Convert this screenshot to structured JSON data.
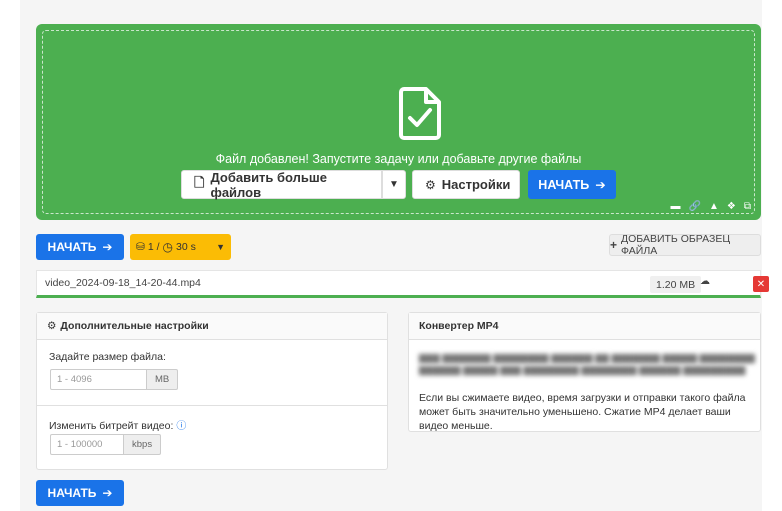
{
  "dropzone": {
    "message": "Файл добавлен! Запустите задачу или добавьте другие файлы",
    "add_more_label": "Добавить больше файлов",
    "settings_label": "Настройки",
    "start_label": "НАЧАТЬ",
    "bg_color": "#4caf50"
  },
  "toolbar": {
    "start_label": "НАЧАТЬ",
    "limit_files": "1 /",
    "limit_time": "30 s",
    "add_sample_label": "ДОБАВИТЬ ОБРАЗЕЦ ФАЙЛА"
  },
  "file": {
    "name": "video_2024-09-18_14-20-44.mp4",
    "size": "1.20 MB"
  },
  "settings": {
    "title": "Дополнительные настройки",
    "file_size_label": "Задайте размер файла:",
    "file_size_placeholder": "1 - 4096",
    "file_size_unit": "MB",
    "bitrate_label": "Изменить битрейт видео:",
    "bitrate_placeholder": "1 - 100000",
    "bitrate_unit": "kbps"
  },
  "converter": {
    "title": "Конвертер MP4",
    "description": "Если вы сжимаете видео, время загрузки и отправки такого файла может быть значительно уменьшено. Сжатие MP4 делает ваши видео меньше."
  },
  "bottom": {
    "start_label": "НАЧАТЬ"
  },
  "colors": {
    "accent": "#1a73e8",
    "warning": "#fbbc05",
    "danger": "#e53935",
    "success": "#4caf50"
  }
}
